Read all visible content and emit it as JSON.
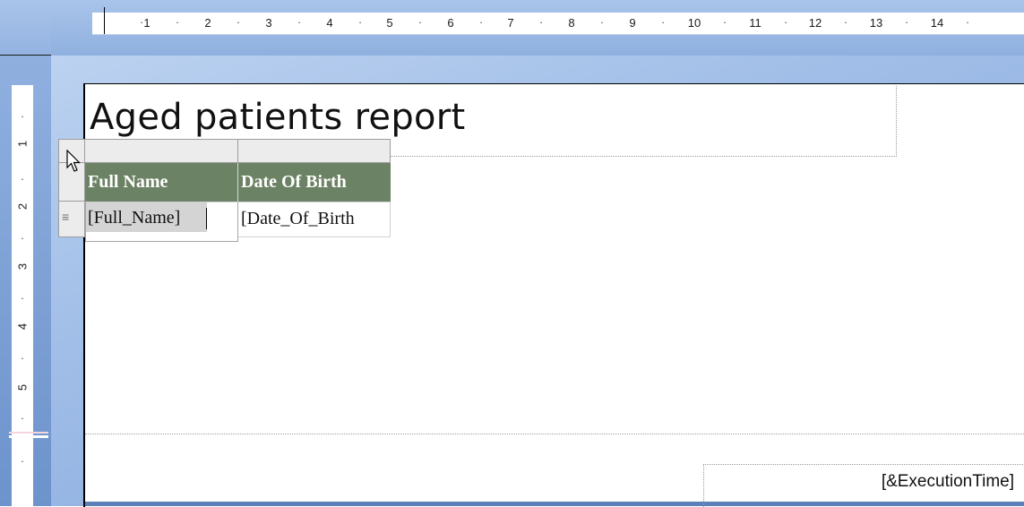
{
  "ruler": {
    "horizontal": [
      "1",
      "2",
      "3",
      "4",
      "5",
      "6",
      "7",
      "8",
      "9",
      "10",
      "11",
      "12",
      "13",
      "14"
    ],
    "vertical": [
      "1",
      "2",
      "3",
      "4",
      "5"
    ]
  },
  "report": {
    "title": "Aged patients report",
    "table": {
      "columns": [
        {
          "header": "Full Name",
          "field": "[Full_Name]"
        },
        {
          "header": "Date Of Birth",
          "field": "[Date_Of_Birth"
        }
      ],
      "selected_cell": 0
    },
    "footer": {
      "execution_time": "[&ExecutionTime]"
    }
  },
  "colors": {
    "header_bg": "#6c8264",
    "header_text": "#ffffff",
    "ruler_blue": "#a9c4ea"
  },
  "icons": {
    "row_handle": "≡",
    "cursor": "arrow-pointer"
  }
}
